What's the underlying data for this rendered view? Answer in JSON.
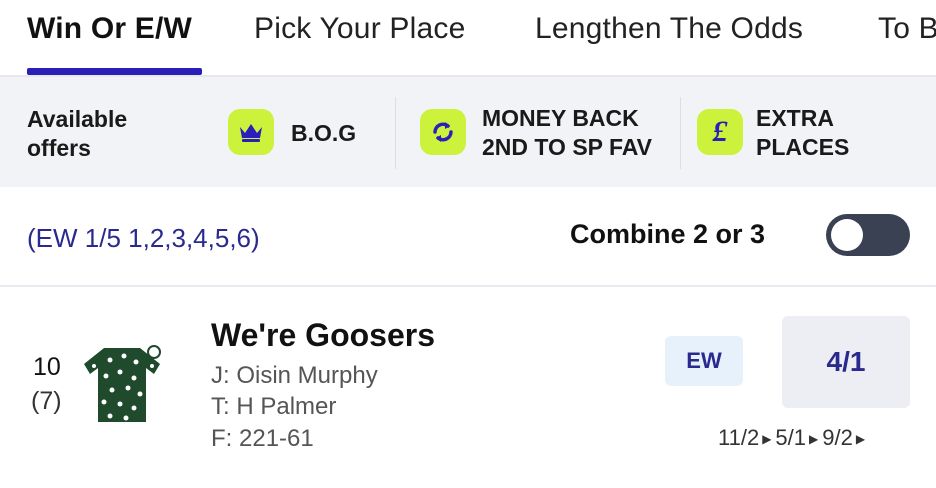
{
  "tabs": [
    {
      "label": "Win Or E/W",
      "active": true
    },
    {
      "label": "Pick Your Place",
      "active": false
    },
    {
      "label": "Lengthen The Odds",
      "active": false
    },
    {
      "label": "To B",
      "active": false
    }
  ],
  "offers": {
    "label_line1": "Available",
    "label_line2": "offers",
    "items": [
      {
        "icon": "crown-icon",
        "line1": "B.O.G",
        "line2": ""
      },
      {
        "icon": "refresh-icon",
        "line1": "MONEY BACK",
        "line2": "2ND TO SP FAV"
      },
      {
        "icon": "pound-sign-icon",
        "line1": "EXTRA",
        "line2": "PLACES"
      }
    ],
    "icon_bg": "#ccf23c",
    "icon_fg": "#2a1fb8"
  },
  "each_way": {
    "terms": "(EW 1/5 1,2,3,4,5,6)",
    "combine_label": "Combine 2 or 3",
    "combine_enabled": false
  },
  "runner": {
    "number": "10",
    "draw": "(7)",
    "name": "We're Goosers",
    "jockey": "J: Oisin Murphy",
    "trainer": "T: H Palmer",
    "form": "F: 221-61",
    "ew_badge": "EW",
    "odds": "4/1",
    "odds_history": [
      "11/2",
      "5/1",
      "9/2"
    ],
    "silks_colors": {
      "primary": "#1f4a2c",
      "spots": "#ffffff"
    }
  },
  "colors": {
    "accent": "#2a1fb8",
    "link_text": "#2a2a8e",
    "offers_bg": "#f2f3f6",
    "toggle_bg": "#3a4152"
  }
}
